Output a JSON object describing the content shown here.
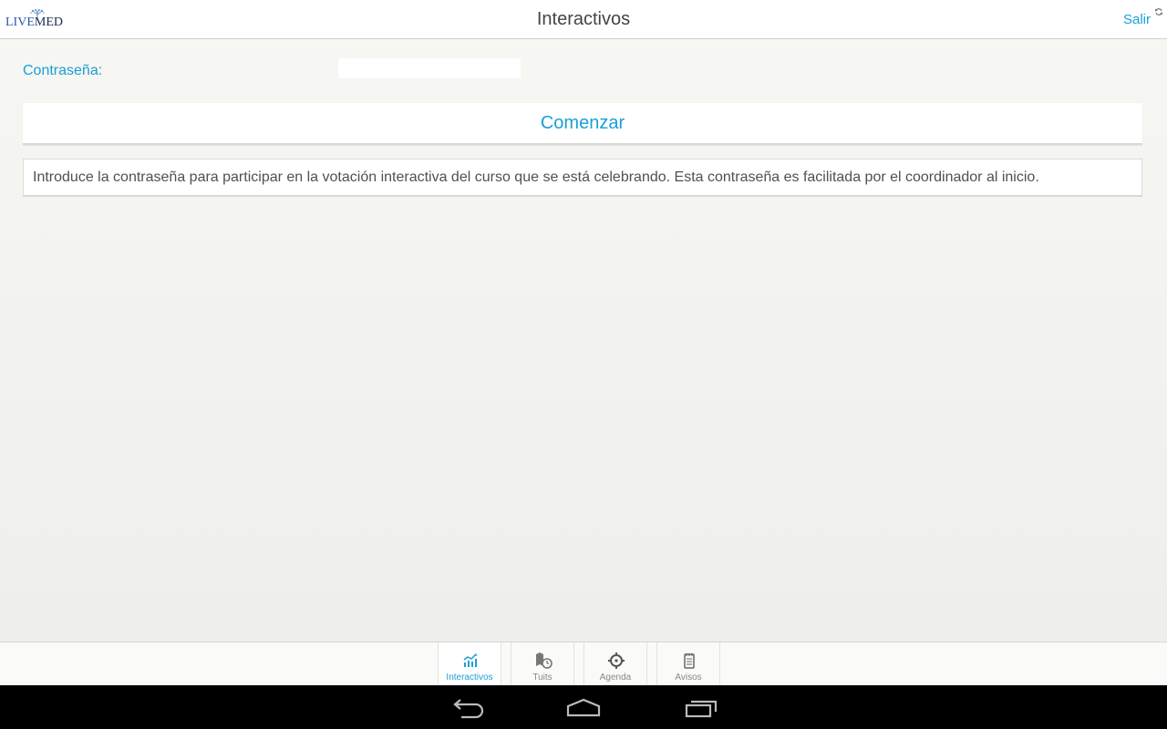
{
  "header": {
    "logo_text_live": "LIVE",
    "logo_text_med": "MED",
    "title": "Interactivos",
    "logout_label": "Salir",
    "refresh_icon": "refresh-icon"
  },
  "form": {
    "password_label": "Contraseña:",
    "password_value": "",
    "start_button_label": "Comenzar",
    "info_text": "Introduce la contraseña para participar en la votación interactiva del curso que se está celebrando. Esta contraseña es facilitada por el coordinador al inicio."
  },
  "tabs": [
    {
      "label": "Interactivos",
      "icon": "chart-icon",
      "active": true
    },
    {
      "label": "Tuits",
      "icon": "map-clock-icon",
      "active": false
    },
    {
      "label": "Agenda",
      "icon": "crosshair-icon",
      "active": false
    },
    {
      "label": "Avisos",
      "icon": "notepad-icon",
      "active": false
    }
  ],
  "colors": {
    "accent": "#1a9fd8",
    "background": "#f2f2ee",
    "navbar": "#000000"
  },
  "system_nav": {
    "back_icon": "back-icon",
    "home_icon": "home-icon",
    "recents_icon": "recents-icon"
  }
}
